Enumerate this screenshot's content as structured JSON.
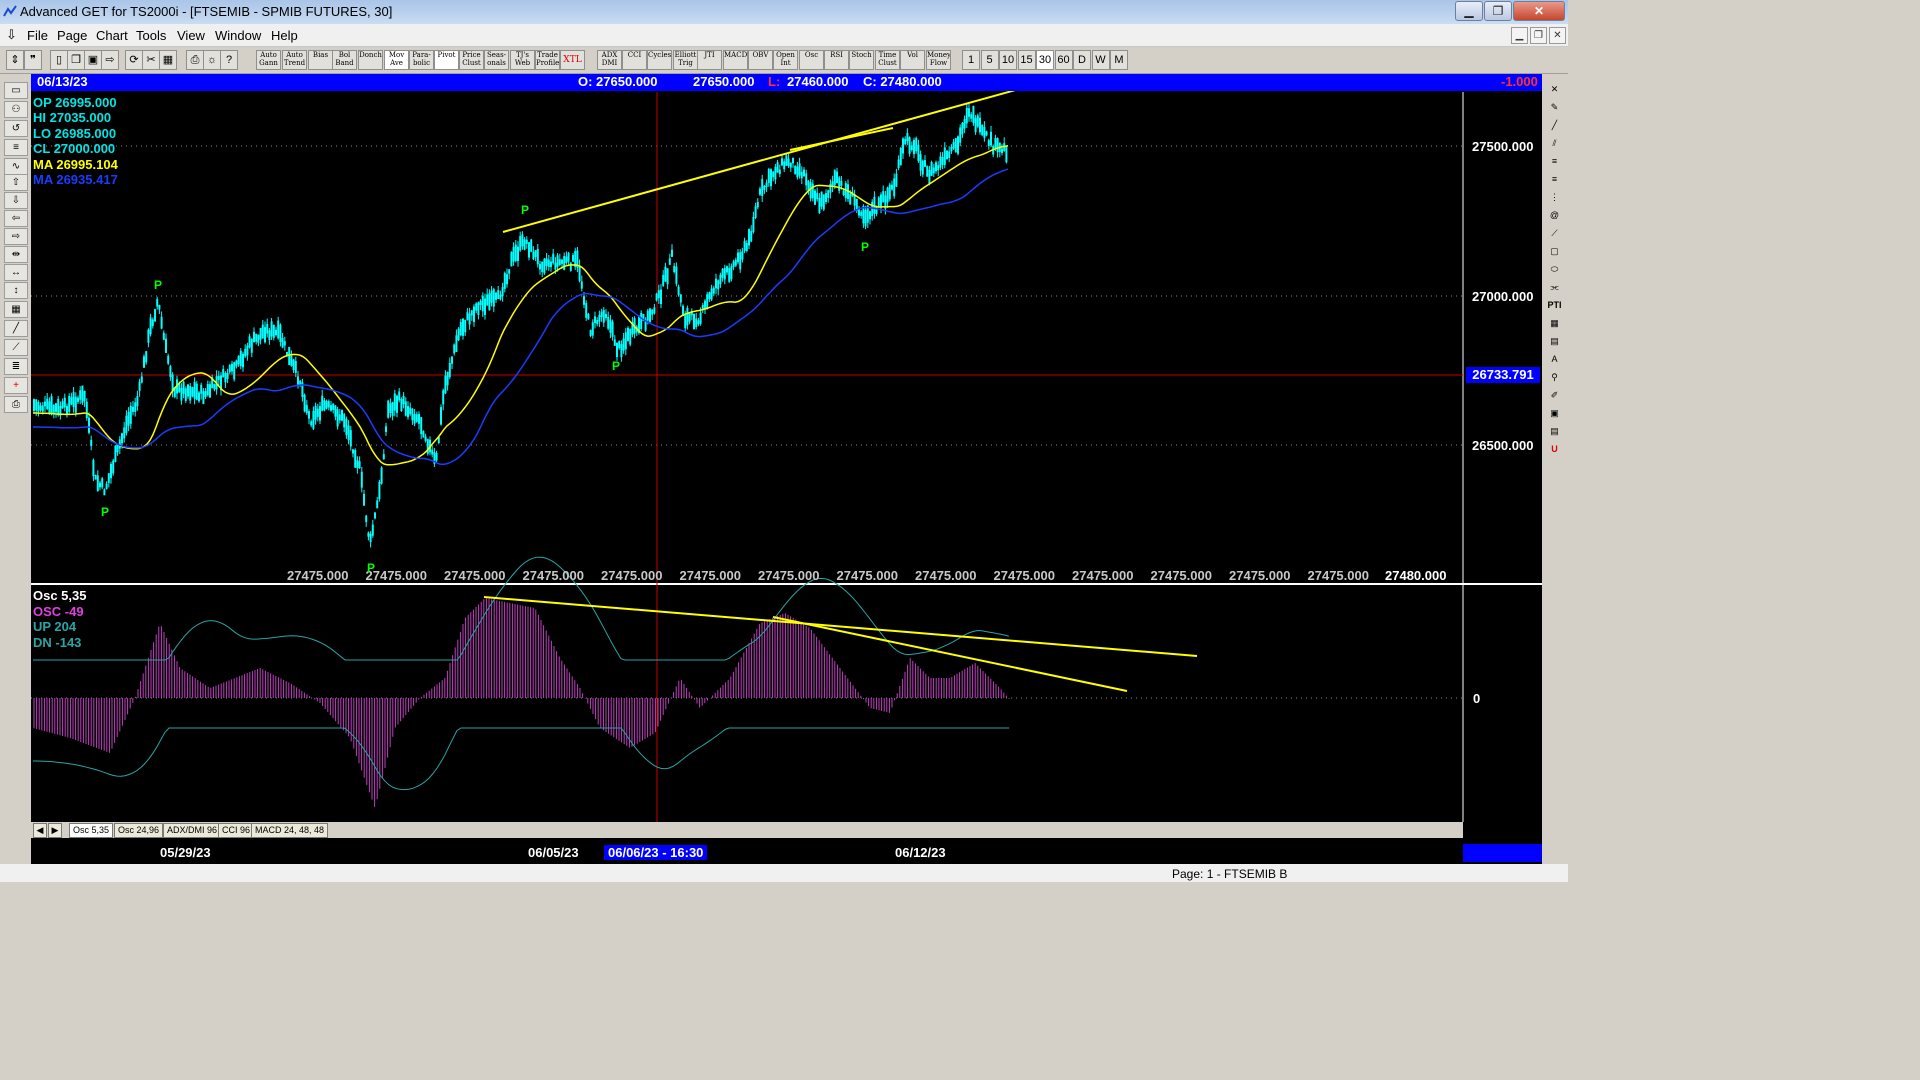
{
  "window": {
    "title": "Advanced GET for TS2000i - [FTSEMIB - SPMIB FUTURES, 30]",
    "minimize": "▁",
    "restore": "❐",
    "close": "✕"
  },
  "menu": [
    "File",
    "Page",
    "Chart",
    "Tools",
    "View",
    "Window",
    "Help"
  ],
  "toolbar": {
    "studies": [
      "Auto Gann",
      "Auto Trend",
      "Bias",
      "Bol Band",
      "Donch",
      "Mov Ave",
      "Para- bolic",
      "Pivot",
      "Price Clust",
      "Seas- onals",
      "TJ's Web",
      "Trade Profile",
      "XTL",
      "ADX DMI",
      "CCI",
      "Cycles",
      "Elliott Trig",
      "JTI",
      "MACD",
      "OBV",
      "Open Int",
      "Osc",
      "RSI",
      "Stoch",
      "Time Clust",
      "Vol",
      "Money Flow"
    ],
    "intervals": [
      "1",
      "5",
      "10",
      "15",
      "30",
      "60",
      "D",
      "W",
      "M"
    ],
    "active_interval": "30"
  },
  "header": {
    "date": "06/13/23",
    "open": "O: 27650.000",
    "high": "27650.000",
    "low_label": "L:",
    "low": "27460.000",
    "close": "C: 27480.000",
    "change": "-1.000"
  },
  "readout": {
    "op": "OP  26995.000",
    "hi": "HI   27035.000",
    "lo": "LO  26985.000",
    "cl": "CL  27000.000",
    "ma1": "MA  26995.104",
    "ma2": "MA  26935.417"
  },
  "price_axis": {
    "ticks": [
      "27500.000",
      "27000.000",
      "26500.000"
    ],
    "cursor_price": "26733.791"
  },
  "price_row": {
    "values": [
      "27475.000",
      "27475.000",
      "27475.000",
      "27475.000",
      "27475.000",
      "27475.000",
      "27475.000",
      "27475.000",
      "27475.000",
      "27475.000",
      "27475.000",
      "27475.000",
      "27475.000",
      "27475.000"
    ],
    "last": "27480.000"
  },
  "pivot_label": "P",
  "oscillator": {
    "name": "Osc 5,35",
    "osc": "OSC -49",
    "up": "UP   204",
    "dn": "DN   -143",
    "zero": "0"
  },
  "tabs": [
    "Osc 5,35",
    "Osc 24,96",
    "ADX/DMI 96",
    "CCI 96",
    "MACD 24, 48, 48"
  ],
  "dates": {
    "d1": "05/29/23",
    "d2": "06/05/23",
    "cursor": "06/06/23 - 16:30",
    "d3": "06/12/23"
  },
  "status": "Page: 1 - FTSEMIB B",
  "colors": {
    "candle": "#00ffff",
    "ma_fast": "#ffff00",
    "ma_slow": "#1a3cff",
    "trendline": "#ffff00",
    "osc_bars": "#c040c0",
    "band": "#2aa5a5",
    "pivot": "#00ff00",
    "crosshair": "#cc0000"
  },
  "chart_data": {
    "type": "candlestick",
    "price_ticks": [
      27500,
      27000,
      26500
    ],
    "cursor_price": 26733.791,
    "pivots": [
      {
        "date": "05/29/23",
        "type": "low"
      },
      {
        "date": "05/30/23",
        "type": "high"
      },
      {
        "date": "06/02/23",
        "type": "low"
      },
      {
        "date": "06/05/23",
        "type": "high"
      },
      {
        "date": "06/06/23",
        "type": "low"
      },
      {
        "date": "06/09/23",
        "type": "low"
      }
    ]
  }
}
